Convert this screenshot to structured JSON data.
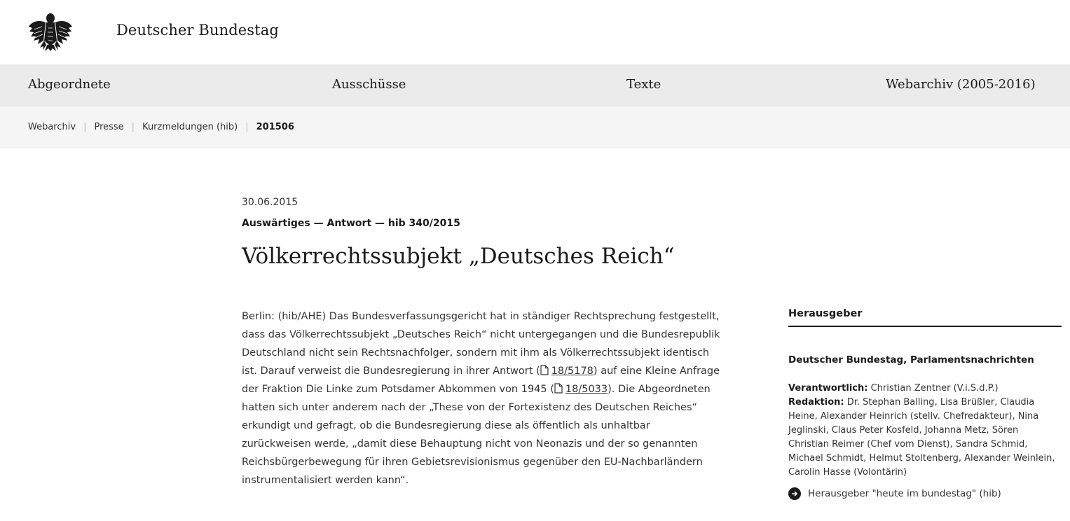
{
  "header": {
    "site_title": "Deutscher Bundestag",
    "logo_icon": "federal-eagle-icon"
  },
  "main_nav": {
    "items": [
      "Abgeordnete",
      "Ausschüsse",
      "Texte",
      "Webarchiv (2005-2016)"
    ]
  },
  "breadcrumb": {
    "items": [
      "Webarchiv",
      "Presse",
      "Kurzmeldungen (hib)"
    ],
    "current": "201506",
    "separator": "|"
  },
  "article": {
    "date": "30.06.2015",
    "kicker": "Auswärtiges — Antwort — hib 340/2015",
    "headline": "Völkerrechtssubjekt „Deutsches Reich“",
    "body_part1": "Berlin: (hib/AHE) Das Bundesverfassungsgericht hat in ständiger Rechtsprechung festgestellt, dass das Völkerrechtssubjekt „Deutsches Reich“ nicht untergegangen und die Bundesrepublik Deutschland nicht sein Rechtsnachfolger, sondern mit ihm als Völkerrechtssubjekt identisch ist. Darauf verweist die Bundesregierung in ihrer Antwort (",
    "link1": "18/5178",
    "body_part2": ") auf eine Kleine Anfrage der Fraktion Die Linke zum Potsdamer Abkommen von 1945 (",
    "link2": "18/5033",
    "body_part3": "). Die Abgeordneten hatten sich unter anderem nach der „These von der Fortexistenz des Deutschen Reiches“ erkundigt und gefragt, ob die Bundesregierung diese als öffentlich als unhaltbar zurückweisen werde, „damit diese Behauptung nicht von Neonazis und der so genannten Reichsbürgerbewegung für ihren Gebietsrevisionismus gegenüber den EU-Nachbarländern instrumentalisiert werden kann“."
  },
  "sidebar": {
    "heading": "Herausgeber",
    "publisher": "Deutscher Bundestag, Parlamentsnachrichten",
    "responsible_label": "Verantwortlich:",
    "responsible_value": "Christian Zentner (V.i.S.d.P.)",
    "editorial_label": "Redaktion:",
    "editorial_value": "Dr. Stephan Balling, Lisa Brüßler, Claudia Heine, Alexander Heinrich (stellv. Chefredakteur), Nina Jeglinski, Claus Peter Kosfeld, Johanna Metz, Sören Christian Reimer (Chef vom Dienst), Sandra Schmid, Michael Schmidt, Helmut Stoltenberg, Alexander Weinlein, Carolin Hasse (Volontärin)",
    "link_label": "Herausgeber \"heute im bundestag\" (hib)",
    "link_icon": "arrow-right-circle-icon"
  }
}
